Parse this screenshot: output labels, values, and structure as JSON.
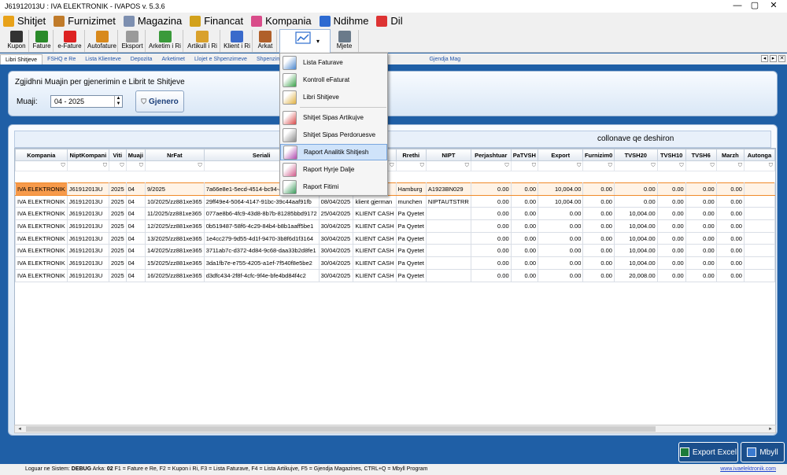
{
  "window": {
    "title": "J61912013U : IVA ELEKTRONIK - IVAPOS v. 5.3.6",
    "controls": [
      "—",
      "▢",
      "✕"
    ]
  },
  "menubar": [
    {
      "label": "Shitjet",
      "color": "#e8a21a"
    },
    {
      "label": "Furnizimet",
      "color": "#c07b2a"
    },
    {
      "label": "Magazina",
      "color": "#7d8fb0"
    },
    {
      "label": "Financat",
      "color": "#d2a11c"
    },
    {
      "label": "Kompania",
      "color": "#d94c8a"
    },
    {
      "label": "Ndihme",
      "color": "#2d6ad1"
    },
    {
      "label": "Dil",
      "color": "#d33"
    }
  ],
  "toolbar": [
    {
      "label": "Kupon",
      "color": "#333"
    },
    {
      "label": "Fature",
      "color": "#2a8a2a"
    },
    {
      "label": "e-Fature",
      "color": "#d22"
    },
    {
      "label": "Autofature",
      "color": "#d8891c"
    },
    {
      "label": "Eksport",
      "color": "#9a9a9a"
    },
    {
      "label": "Arketim i Ri",
      "color": "#3a9a3a"
    },
    {
      "label": "Artikull i Ri",
      "color": "#d9a12c"
    },
    {
      "label": "Klient i Ri",
      "color": "#3a6acb"
    },
    {
      "label": "Arkat",
      "color": "#b0602a"
    },
    {
      "label": "",
      "color": "#2f6fcf"
    },
    {
      "label": "Mjete",
      "color": "#6a7a8a"
    }
  ],
  "tabs": [
    "Libri Shitjeve",
    "FSHQ e Re",
    "Lista Klienteve",
    "Depozita",
    "Arketimet",
    "Llojet e Shpenzimeve",
    "Shpenzimet",
    "FA",
    "Gjendja Mag"
  ],
  "top_panel": {
    "heading": "Zgjidhni Muajin per gjenerimin e Librit te Shitjeve",
    "month_label": "Muaji:",
    "month_value": "04 - 2025",
    "generate_button": "Gjenero"
  },
  "group_hint": "collonave qe deshiron",
  "grid": {
    "columns": [
      "Kompania",
      "NiptKompani",
      "Viti",
      "Muaji",
      "NrFat",
      "Seriali",
      "",
      "r",
      "Rrethi",
      "NIPT",
      "Perjashtuar",
      "PaTVSH",
      "Export",
      "Furnizim0",
      "TVSH20",
      "TVSH10",
      "TVSH6",
      "Marzh",
      "Autonga"
    ],
    "rows": [
      [
        "IVA ELEKTRONIK",
        "J61912013U",
        "2025",
        "04",
        "9/2025",
        "7a66e8e1-5ecd-4514-bc94-4",
        "",
        "s",
        "Hamburg",
        "A1923BN029",
        "0.00",
        "0.00",
        "10,004.00",
        "0.00",
        "0.00",
        "0.00",
        "0.00",
        "0.00",
        ""
      ],
      [
        "IVA ELEKTRONIK",
        "J61912013U",
        "2025",
        "04",
        "10/2025/zz881xe365",
        "29ff49e4-5064-4147-91bc-39c44aaf91fb",
        "08/04/2025",
        "klient gjerman",
        "munchen",
        "NIPTAUTSTRR",
        "0.00",
        "0.00",
        "10,004.00",
        "0.00",
        "0.00",
        "0.00",
        "0.00",
        "0.00",
        ""
      ],
      [
        "IVA ELEKTRONIK",
        "J61912013U",
        "2025",
        "04",
        "11/2025/zz881xe365",
        "077ae8b6-4fc9-43d8-8b7b-81285bbd9172",
        "25/04/2025",
        "KLIENT CASH",
        "Pa Qyetet",
        "",
        "0.00",
        "0.00",
        "0.00",
        "0.00",
        "10,004.00",
        "0.00",
        "0.00",
        "0.00",
        ""
      ],
      [
        "IVA ELEKTRONIK",
        "J61912013U",
        "2025",
        "04",
        "12/2025/zz881xe365",
        "0b519487-58f6-4c29-84b4-b8b1aaff5be1",
        "30/04/2025",
        "KLIENT CASH",
        "Pa Qyetet",
        "",
        "0.00",
        "0.00",
        "0.00",
        "0.00",
        "10,004.00",
        "0.00",
        "0.00",
        "0.00",
        ""
      ],
      [
        "IVA ELEKTRONIK",
        "J61912013U",
        "2025",
        "04",
        "13/2025/zz881xe365",
        "1e4cc279-9d55-4d1f-9470-3b8f6d1f3164",
        "30/04/2025",
        "KLIENT CASH",
        "Pa Qyetet",
        "",
        "0.00",
        "0.00",
        "0.00",
        "0.00",
        "10,004.00",
        "0.00",
        "0.00",
        "0.00",
        ""
      ],
      [
        "IVA ELEKTRONIK",
        "J61912013U",
        "2025",
        "04",
        "14/2025/zz881xe365",
        "3711ab7c-d372-4d84-9c68-daa33b2d8fe1",
        "30/04/2025",
        "KLIENT CASH",
        "Pa Qyetet",
        "",
        "0.00",
        "0.00",
        "0.00",
        "0.00",
        "10,004.00",
        "0.00",
        "0.00",
        "0.00",
        ""
      ],
      [
        "IVA ELEKTRONIK",
        "J61912013U",
        "2025",
        "04",
        "15/2025/zz881xe365",
        "3da1fb7e-e755-4205-a1ef-7f540f8e5be2",
        "30/04/2025",
        "KLIENT CASH",
        "Pa Qyetet",
        "",
        "0.00",
        "0.00",
        "0.00",
        "0.00",
        "10,004.00",
        "0.00",
        "0.00",
        "0.00",
        ""
      ],
      [
        "IVA ELEKTRONIK",
        "J61912013U",
        "2025",
        "04",
        "16/2025/zz881xe365",
        "d3dfc434-2f8f-4cfc-9f4e-bfe4bd84f4c2",
        "30/04/2025",
        "KLIENT CASH",
        "Pa Qyetet",
        "",
        "0.00",
        "0.00",
        "0.00",
        "0.00",
        "20,008.00",
        "0.00",
        "0.00",
        "0.00",
        ""
      ]
    ]
  },
  "dropdown": [
    {
      "label": "Lista Faturave",
      "color": "#4a86cf"
    },
    {
      "label": "Kontroll eFaturat",
      "color": "#3aa24a"
    },
    {
      "label": "Libri Shitjeve",
      "color": "#e0b040"
    },
    {
      "label": "Shitjet Sipas Artikujve",
      "color": "#d94a4a"
    },
    {
      "label": "Shitjet Sipas Perdoruesve",
      "color": "#8a8a8a"
    },
    {
      "label": "Raport Analitik Shitjesh",
      "color": "#b04ab0"
    },
    {
      "label": "Raport Hyrje Dalje",
      "color": "#d05a8a"
    },
    {
      "label": "Raport Fitimi",
      "color": "#3a9a5a"
    }
  ],
  "buttons": {
    "export_excel": "Export Excel",
    "close": "Mbyll"
  },
  "status": {
    "login_label": "Loguar ne Sistem:",
    "user": "DEBUG",
    "arka_label": "Arka:",
    "arka_value": "02",
    "shortcuts": "F1 = Fature e Re, F2 = Kupon i Ri, F3 = Lista Faturave, F4 = Lista Artikujve, F5 = Gjendja Magazines, CTRL+Q = Mbyll Program",
    "link": "www.ivaelektronik.com"
  }
}
